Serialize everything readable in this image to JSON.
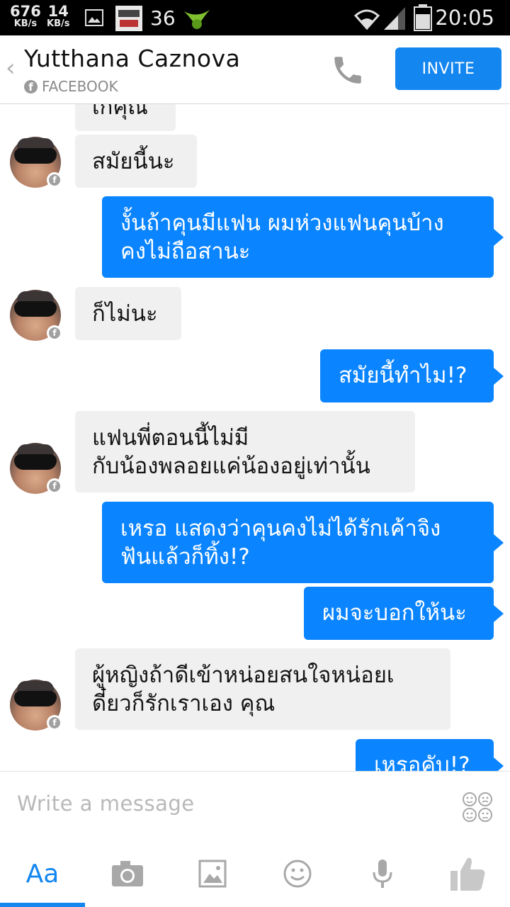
{
  "status_bar": {
    "speed1": {
      "value": "676",
      "unit": "KB/s"
    },
    "speed2": {
      "value": "14",
      "unit": "KB/s"
    },
    "notification_count": "36",
    "time": "20:05"
  },
  "header": {
    "title": "Yutthana Caznova",
    "subtitle": "FACEBOOK",
    "invite_label": "INVITE"
  },
  "messages": [
    {
      "side": "in",
      "text": "เกิคุณ"
    },
    {
      "side": "in",
      "text": "สมัยนี้นะ"
    },
    {
      "side": "out",
      "line1": "งั้นถ้าคุนมีแฟน ผมห่วงแฟนคุนบ้าง",
      "line2": "คงไม่ถือสานะ"
    },
    {
      "side": "in",
      "text": "ก็ไม่นะ"
    },
    {
      "side": "out",
      "text": "สมัยนี้ทำไม!?"
    },
    {
      "side": "in",
      "line1": "แฟนพี่ตอนนี้ไม่มี",
      "line2": "กับน้องพลอยแค่น้องอยู่เท่านั้น"
    },
    {
      "side": "out",
      "line1": "เหรอ แสดงว่าคุนคงไม่ได้รักเค้าจิง",
      "line2": "ฟันแล้วก็ทิ้ง!?"
    },
    {
      "side": "out",
      "text": "ผมจะบอกให้นะ"
    },
    {
      "side": "in",
      "line1": "ผู้หญิงถ้าดีเข้าหน่อยสนใจหน่อยเ",
      "line2": "ดี๋ยวก็รักเราเอง คุณ"
    },
    {
      "side": "out",
      "text": "เหรอคับ!?"
    }
  ],
  "composer": {
    "placeholder": "Write a message"
  },
  "toolbar": {
    "text_tab_label": "Aa"
  },
  "colors": {
    "accent": "#1386f0",
    "outgoing_bubble": "#0a84ff",
    "incoming_bubble": "#f1f0f0"
  }
}
